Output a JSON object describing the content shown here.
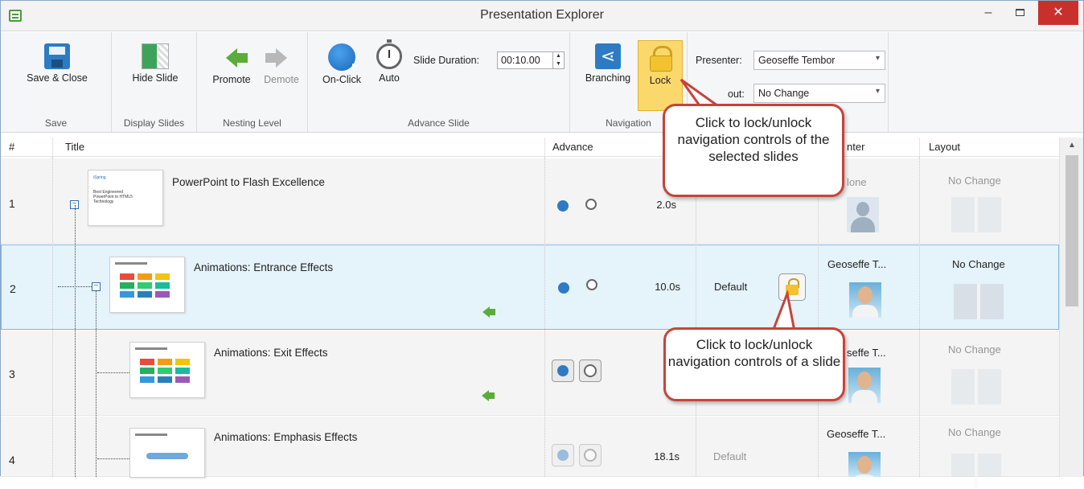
{
  "window": {
    "title": "Presentation Explorer",
    "close_glyph": "✕",
    "minimize_glyph": "–"
  },
  "ribbon": {
    "save_group": {
      "label": "Save",
      "save_close": "Save & Close"
    },
    "display_group": {
      "label": "Display Slides",
      "hide_slide": "Hide Slide"
    },
    "nesting_group": {
      "label": "Nesting Level",
      "promote": "Promote",
      "demote": "Demote"
    },
    "advance_group": {
      "label": "Advance Slide",
      "on_click": "On-Click",
      "auto": "Auto",
      "duration_label": "Slide Duration:",
      "duration_value": "00:10.00"
    },
    "navigation_group": {
      "label": "Navigation",
      "branching": "Branching",
      "lock": "Lock"
    },
    "presenter_group": {
      "presenter_label": "Presenter:",
      "presenter_value": "Geoseffe Tembor",
      "layout_label_visible": "out:",
      "layout_value": "No Change"
    }
  },
  "grid": {
    "columns": {
      "num": "#",
      "title": "Title",
      "advance": "Advance",
      "presenter_visible": "nter",
      "layout": "Layout"
    },
    "rows": [
      {
        "num": "1",
        "title": "PowerPoint to Flash Excellence",
        "duration": "2.0s",
        "presenter": "lone",
        "layout": "No Change"
      },
      {
        "num": "2",
        "title": "Animations: Entrance Effects",
        "duration": "10.0s",
        "navigation": "Default",
        "presenter": "Geoseffe T...",
        "layout": "No Change"
      },
      {
        "num": "3",
        "title": "Animations: Exit Effects",
        "presenter": "seffe T...",
        "layout": "No Change"
      },
      {
        "num": "4",
        "title": "Animations: Emphasis Effects",
        "duration": "18.1s",
        "navigation": "Default",
        "presenter": "Geoseffe T...",
        "layout": "No Change"
      }
    ]
  },
  "thumbnails": {
    "slide1": {
      "logo": "iSpring",
      "lines": [
        "Best Engineered",
        "PowerPoint to HTML5",
        "Technology"
      ]
    }
  },
  "callouts": {
    "top": "Click to lock/unlock navigation controls of the selected slides",
    "bottom": "Click to lock/unlock navigation controls of a slide"
  }
}
